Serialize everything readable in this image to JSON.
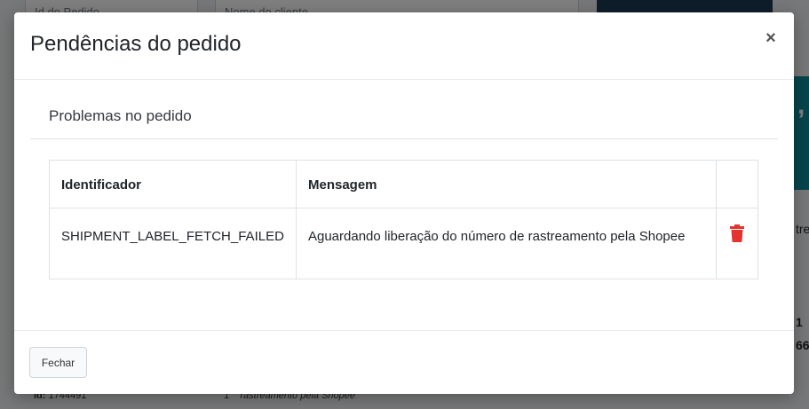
{
  "background": {
    "filter_1_placeholder": "Id do Pedido",
    "filter_2_placeholder": "Nome do cliente",
    "teal_box_text": ",",
    "side_text_1": "tre",
    "side_text_2": "1",
    "side_text_3": "66",
    "bottom_row_label": "Id:",
    "bottom_row_value": "1744491",
    "bottom_row_qty": "1",
    "bottom_row_msg": "rastreamento pela Shopee"
  },
  "modal": {
    "title": "Pendências do pedido",
    "close_glyph": "×",
    "section_title": "Problemas no pedido",
    "table": {
      "headers": [
        "Identificador",
        "Mensagem",
        ""
      ],
      "rows": [
        {
          "identifier": "SHIPMENT_LABEL_FETCH_FAILED",
          "message": "Aguardando liberação do número de rastreamento pela Shopee",
          "action_icon": "trash-icon"
        }
      ]
    },
    "footer": {
      "close_button_label": "Fechar"
    }
  },
  "colors": {
    "danger": "#e3342f",
    "overlay": "rgba(0,0,0,0.5)",
    "teal": "#0c8a98"
  }
}
